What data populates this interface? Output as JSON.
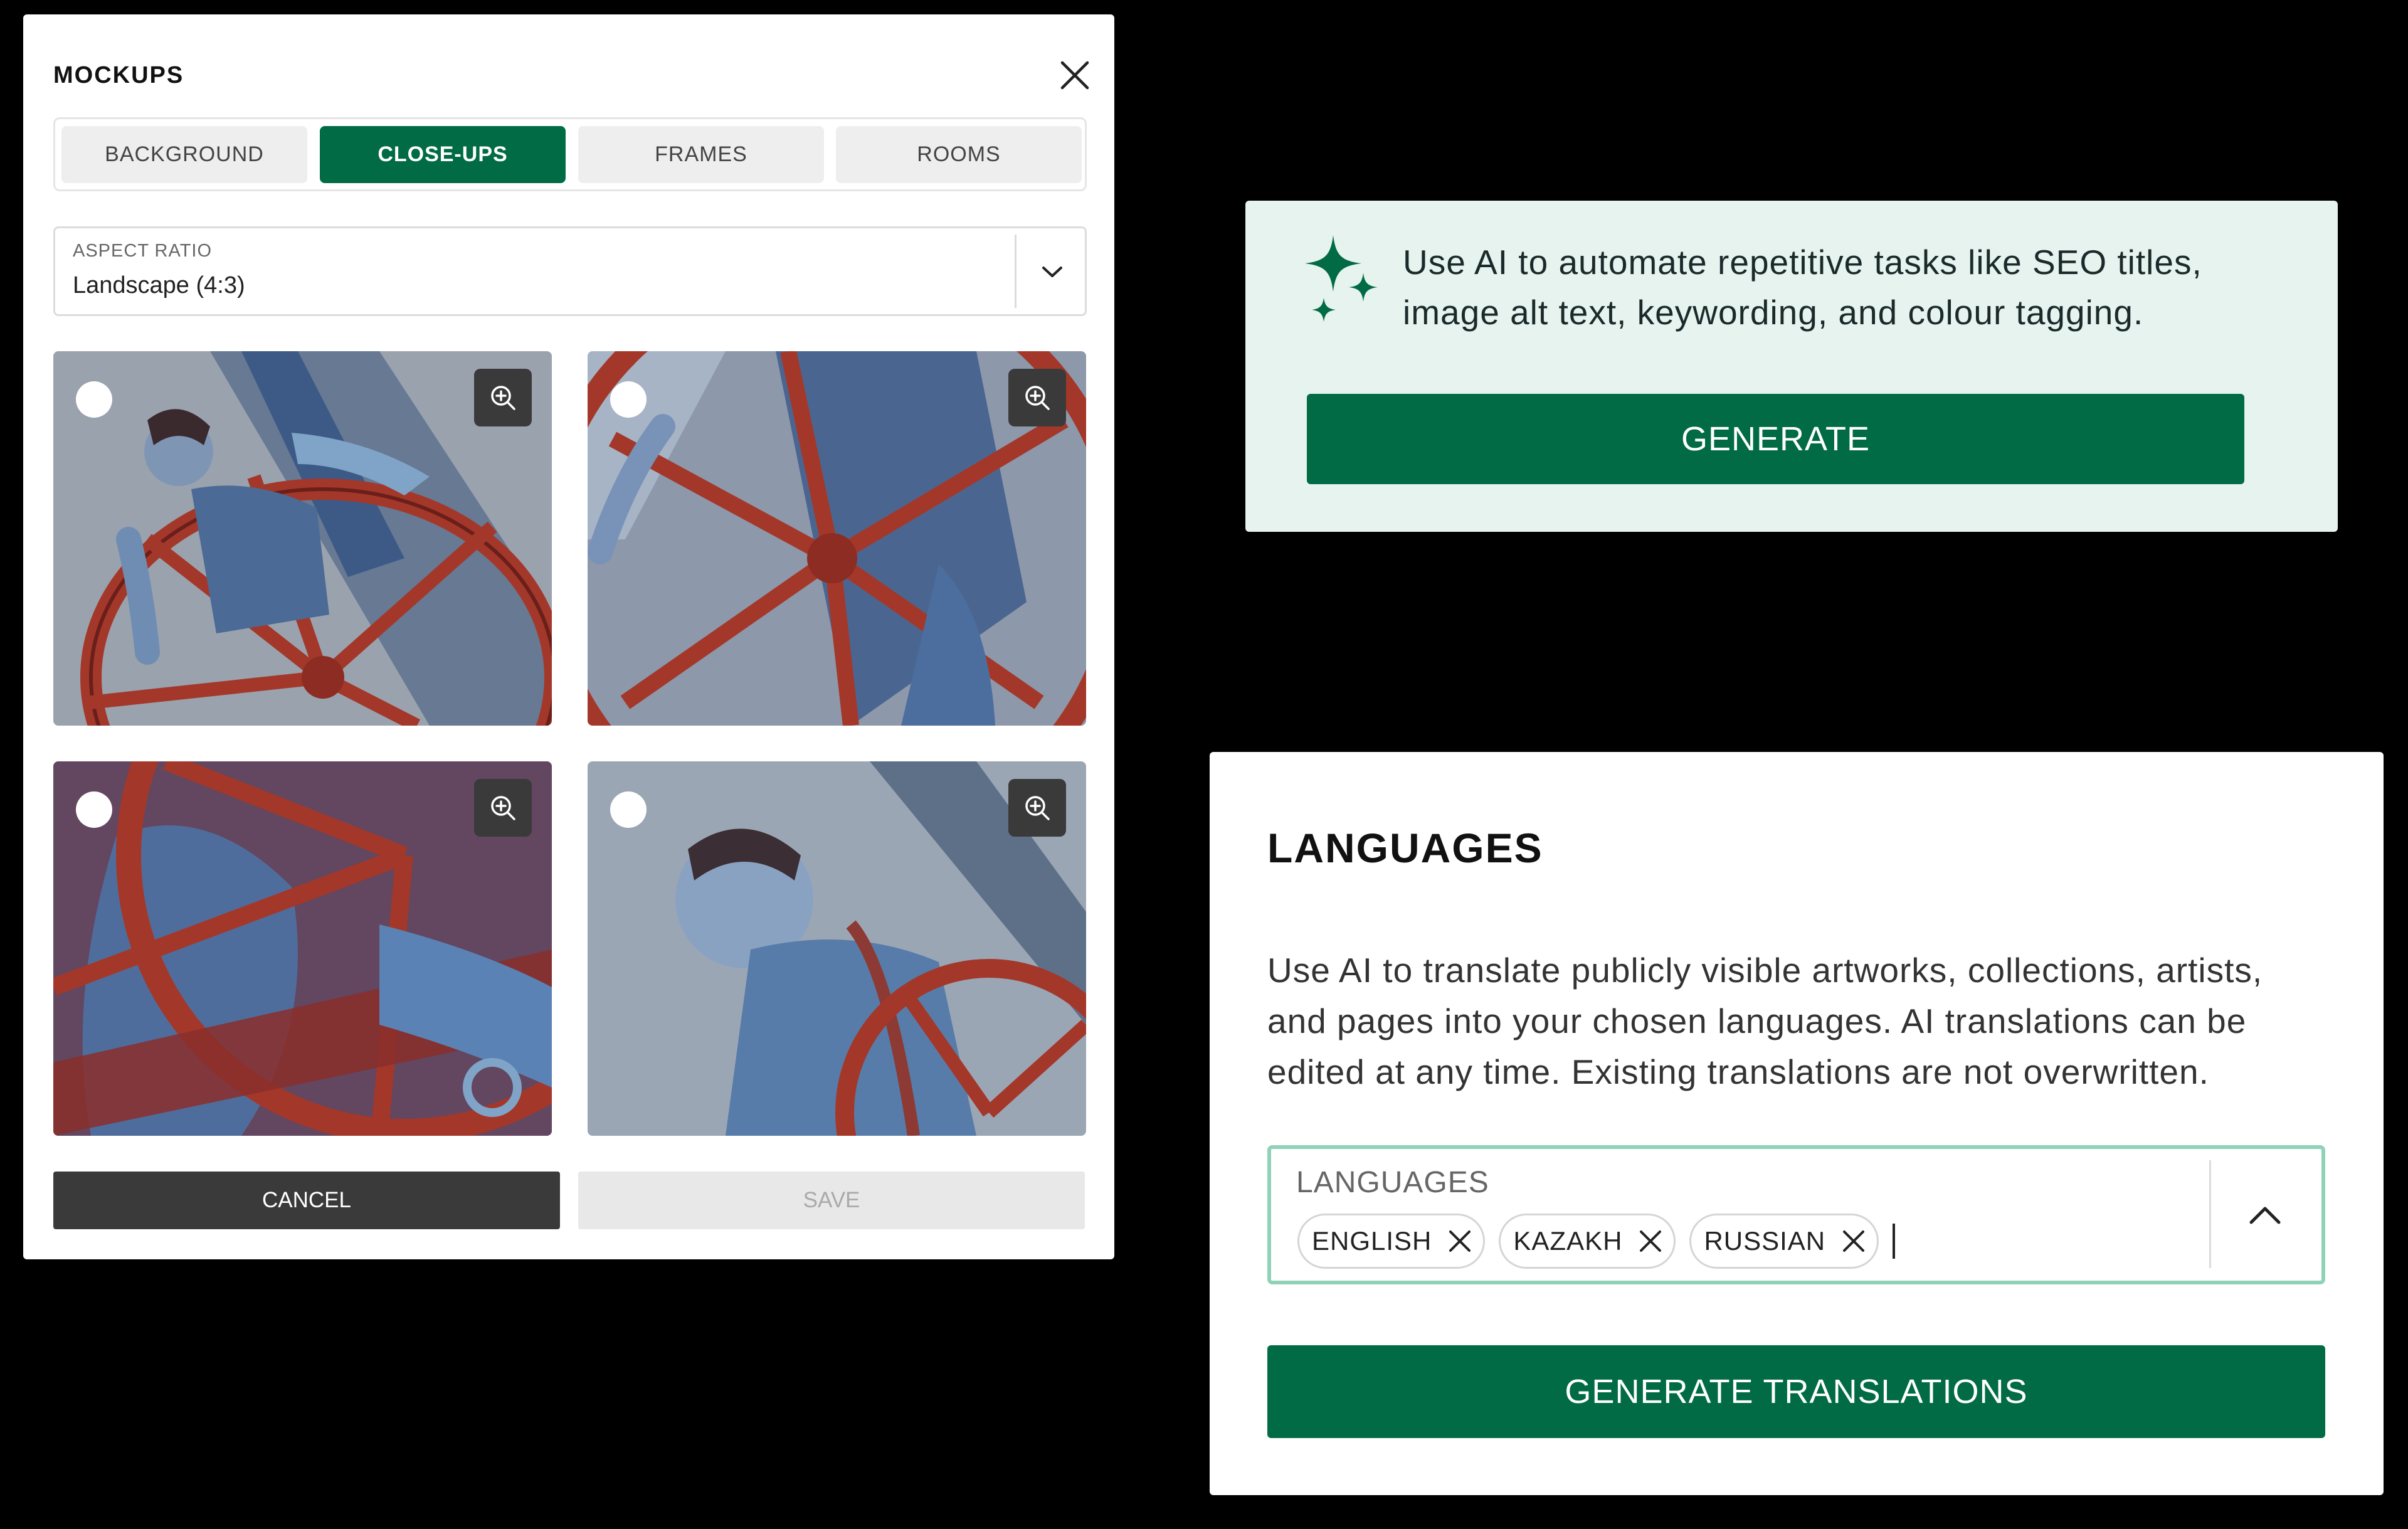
{
  "mockups": {
    "title": "MOCKUPS",
    "close_icon": "close-icon",
    "tabs": [
      {
        "label": "BACKGROUND",
        "active": false
      },
      {
        "label": "CLOSE-UPS",
        "active": true
      },
      {
        "label": "FRAMES",
        "active": false
      },
      {
        "label": "ROOMS",
        "active": false
      }
    ],
    "aspect_ratio": {
      "label": "ASPECT RATIO",
      "value": "Landscape (4:3)"
    },
    "thumbnails": [
      {
        "selected": false,
        "zoom_icon": "zoom-in-icon"
      },
      {
        "selected": false,
        "zoom_icon": "zoom-in-icon"
      },
      {
        "selected": false,
        "zoom_icon": "zoom-in-icon"
      },
      {
        "selected": false,
        "zoom_icon": "zoom-in-icon"
      }
    ],
    "cancel_label": "CANCEL",
    "save_label": "SAVE"
  },
  "ai_card": {
    "icon": "sparkles-icon",
    "line1": "Use AI to automate repetitive tasks like SEO titles,",
    "line2": "image alt text, keywording, and colour tagging.",
    "button_label": "GENERATE"
  },
  "languages": {
    "title": "LANGUAGES",
    "desc_line1": "Use AI to translate publicly visible artworks, collections, artists,",
    "desc_line2": "and pages into your chosen languages. AI translations can be",
    "desc_line3": "edited at any time. Existing translations are not overwritten.",
    "field_label": "LANGUAGES",
    "chips": [
      {
        "label": "ENGLISH"
      },
      {
        "label": "KAZAKH"
      },
      {
        "label": "RUSSIAN"
      }
    ],
    "button_label": "GENERATE TRANSLATIONS"
  },
  "colors": {
    "brand_green": "#006b44",
    "ai_card_bg": "#e6f3ee",
    "field_focus_border": "#8fd2b8",
    "dark_button": "#3a3a3a"
  }
}
